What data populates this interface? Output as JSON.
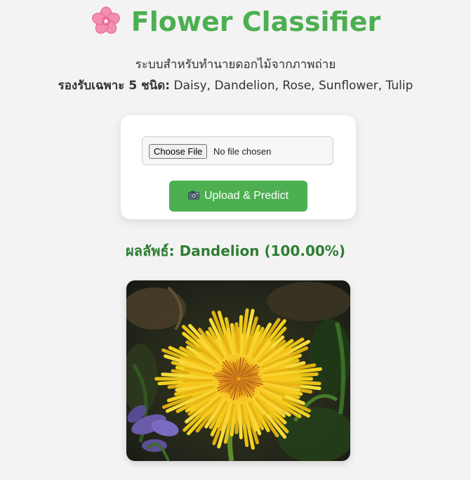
{
  "header": {
    "title": "Flower Classifier",
    "title_icon": "cherry-blossom-icon",
    "title_color": "#4caf50"
  },
  "intro": {
    "description": "ระบบสำหรับทำนายดอกไม้จากภาพถ่าย",
    "support_label": "รองรับเฉพาะ 5 ชนิด:",
    "support_list": "Daisy, Dandelion, Rose, Sunflower, Tulip"
  },
  "upload_card": {
    "choose_file_label": "Choose File",
    "file_status": "No file chosen",
    "upload_button_label": "Upload & Predict",
    "upload_button_icon": "camera-icon",
    "button_color": "#4caf50"
  },
  "result": {
    "text": "ผลลัพธ์: Dandelion (100.00%)",
    "text_color": "#2e7d32"
  },
  "preview": {
    "image_subject": "yellow dandelion flower",
    "image_icon": "dandelion-photo"
  }
}
